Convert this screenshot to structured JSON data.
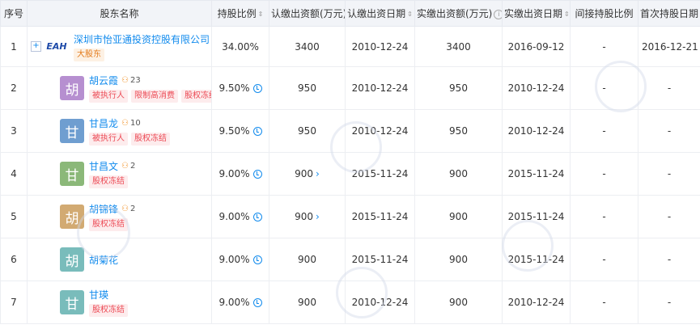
{
  "headers": [
    "序号",
    "股东名称",
    "持股比例",
    "认缴出资额(万元)",
    "认缴出资日期",
    "实缴出资额(万元)",
    "实缴出资日期",
    "间接持股比例",
    "首次持股日期"
  ],
  "rows": [
    {
      "idx": "1",
      "name": "深圳市怡亚通投资控股有限公司",
      "logo": "EAH",
      "avatar_char": "",
      "avatar_color": "",
      "relation": "",
      "tags": [
        {
          "text": "大股东",
          "style": "orange"
        }
      ],
      "ratio": "34.00%",
      "sub_amount": "3400",
      "sub_date": "2010-12-24",
      "paid_amount": "3400",
      "paid_date": "2016-09-12",
      "indirect": "-",
      "first_date": "2016-12-21"
    },
    {
      "idx": "2",
      "name": "胡云霞",
      "logo": "",
      "avatar_char": "胡",
      "avatar_color": "#b68fd0",
      "relation": "23",
      "tags": [
        {
          "text": "被执行人",
          "style": "red"
        },
        {
          "text": "限制高消费",
          "style": "red"
        },
        {
          "text": "股权冻结",
          "style": "red"
        }
      ],
      "ratio": "9.50%",
      "sub_amount": "950",
      "sub_date": "2010-12-24",
      "paid_amount": "950",
      "paid_date": "2010-12-24",
      "indirect": "-",
      "first_date": "-"
    },
    {
      "idx": "3",
      "name": "甘昌龙",
      "logo": "",
      "avatar_char": "甘",
      "avatar_color": "#6f9ed0",
      "relation": "10",
      "tags": [
        {
          "text": "被执行人",
          "style": "red"
        },
        {
          "text": "股权冻结",
          "style": "red"
        }
      ],
      "ratio": "9.50%",
      "sub_amount": "950",
      "sub_date": "2010-12-24",
      "paid_amount": "950",
      "paid_date": "2010-12-24",
      "indirect": "-",
      "first_date": "-"
    },
    {
      "idx": "4",
      "name": "甘昌文",
      "logo": "",
      "avatar_char": "甘",
      "avatar_color": "#8bb879",
      "relation": "2",
      "tags": [
        {
          "text": "股权冻结",
          "style": "red"
        }
      ],
      "ratio": "9.00%",
      "sub_amount": "900",
      "sub_date": "2015-11-24",
      "paid_amount": "900",
      "paid_date": "2015-11-24",
      "indirect": "-",
      "first_date": "-"
    },
    {
      "idx": "5",
      "name": "胡锦锋",
      "logo": "",
      "avatar_char": "胡",
      "avatar_color": "#d2aa72",
      "relation": "2",
      "tags": [
        {
          "text": "股权冻结",
          "style": "red"
        }
      ],
      "ratio": "9.00%",
      "sub_amount": "900",
      "sub_date": "2015-11-24",
      "paid_amount": "900",
      "paid_date": "2015-11-24",
      "indirect": "-",
      "first_date": "-"
    },
    {
      "idx": "6",
      "name": "胡菊花",
      "logo": "",
      "avatar_char": "胡",
      "avatar_color": "#79bcbb",
      "relation": "",
      "tags": [],
      "ratio": "9.00%",
      "sub_amount": "900",
      "sub_date": "2015-11-24",
      "paid_amount": "900",
      "paid_date": "2015-11-24",
      "indirect": "-",
      "first_date": "-"
    },
    {
      "idx": "7",
      "name": "甘瑛",
      "logo": "",
      "avatar_char": "甘",
      "avatar_color": "#79bcbb",
      "relation": "",
      "tags": [
        {
          "text": "股权冻结",
          "style": "red"
        }
      ],
      "ratio": "9.00%",
      "sub_amount": "900",
      "sub_date": "2010-12-24",
      "paid_amount": "900",
      "paid_date": "2010-12-24",
      "indirect": "-",
      "first_date": "-"
    }
  ],
  "icons": {
    "sort": "sort-icon",
    "info": "info-icon",
    "relation": "relation-icon",
    "clock": "history-clock-icon",
    "chevron": "chevron-right-icon",
    "expand": "expand-plus-icon"
  },
  "sub_amount_chevron_rows": [
    3,
    4
  ],
  "clock_rows": [
    1,
    2,
    3,
    4,
    5,
    6
  ],
  "sortable_cols": [
    2,
    3,
    4,
    5,
    6
  ],
  "info_cols": [
    5
  ],
  "colors": {
    "link": "#128bed",
    "header_bg": "#f2f4f8"
  }
}
